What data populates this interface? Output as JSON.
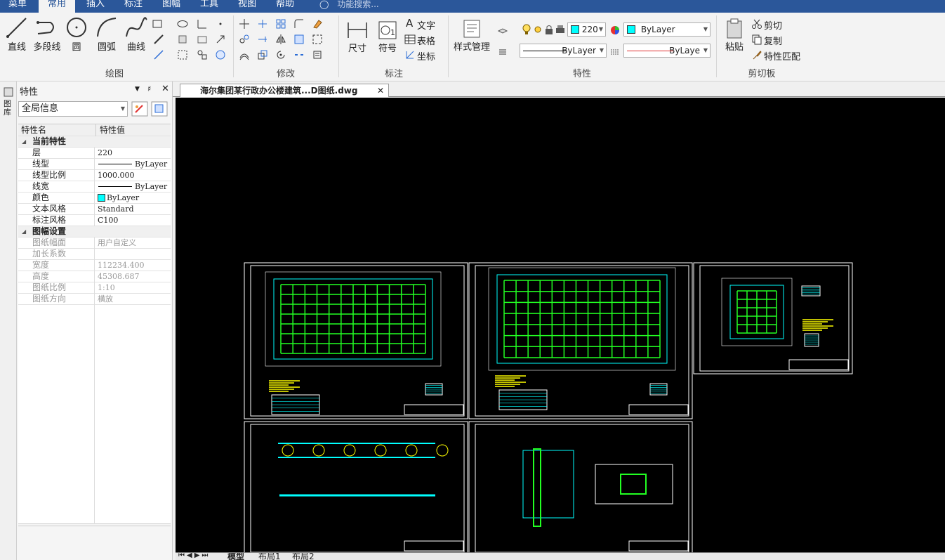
{
  "menubar": {
    "tabs": [
      "菜单",
      "常用",
      "插入",
      "标注",
      "图幅",
      "工具",
      "视图",
      "帮助"
    ],
    "active": "常用",
    "search_placeholder": "功能搜索..."
  },
  "ribbon": {
    "draw": {
      "label": "绘图",
      "line": "直线",
      "polyline": "多段线",
      "circle": "圆",
      "arc": "圆弧",
      "curve": "曲线"
    },
    "modify": {
      "label": "修改"
    },
    "dimension": {
      "label": "标注",
      "dim": "尺寸",
      "symbol": "符号",
      "text": "文字",
      "table": "表格",
      "coord": "坐标"
    },
    "props": {
      "label": "特性",
      "style_mgr": "样式管理",
      "layer_value": "220",
      "color_value": "ByLayer",
      "linetype_value": "ByLayer",
      "lineweight_value": "ByLaye"
    },
    "clipboard": {
      "label": "剪切板",
      "paste": "粘贴",
      "cut": "剪切",
      "copy": "复制",
      "match": "特性匹配"
    }
  },
  "side_strip": {
    "label": "图库"
  },
  "properties_panel": {
    "title": "特性",
    "selector_value": "全局信息",
    "col_name": "特性名",
    "col_value": "特性值",
    "sections": [
      {
        "title": "当前特性",
        "rows": [
          {
            "k": "层",
            "v": "220"
          },
          {
            "k": "线型",
            "v": "ByLayer",
            "line": true
          },
          {
            "k": "线型比例",
            "v": "1000.000"
          },
          {
            "k": "线宽",
            "v": "ByLayer",
            "line": true
          },
          {
            "k": "颜色",
            "v": "ByLayer",
            "swatch": true
          },
          {
            "k": "文本风格",
            "v": "Standard"
          },
          {
            "k": "标注风格",
            "v": "C100"
          }
        ]
      },
      {
        "title": "图幅设置",
        "rows": [
          {
            "k": "图纸幅面",
            "v": "用户自定义",
            "disabled": true
          },
          {
            "k": "加长系数",
            "v": "",
            "disabled": true
          },
          {
            "k": "宽度",
            "v": "112234.400",
            "disabled": true
          },
          {
            "k": "高度",
            "v": "45308.687",
            "disabled": true
          },
          {
            "k": "图纸比例",
            "v": "1:10",
            "disabled": true
          },
          {
            "k": "图纸方向",
            "v": "横放",
            "disabled": true
          }
        ]
      }
    ]
  },
  "document": {
    "tab_title": "海尔集团某行政办公楼建筑...D图纸.dwg"
  },
  "layout_tabs": [
    "模型",
    "布局1",
    "布局2"
  ],
  "colors": {
    "accent": "#2b579a",
    "canvas": "#000000",
    "cad_white": "#ffffff",
    "cad_green": "#22ff22",
    "cad_cyan": "#00ffff",
    "cad_yellow": "#ffff00"
  }
}
